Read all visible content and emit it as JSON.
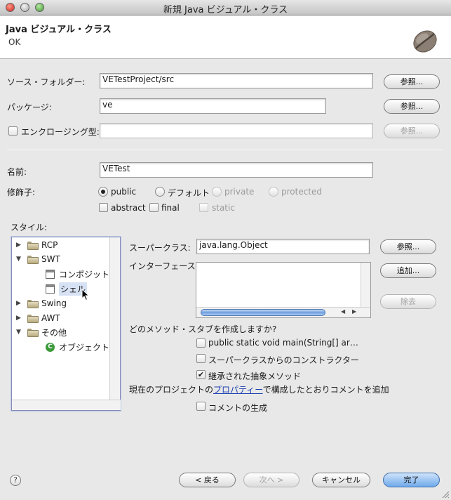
{
  "window": {
    "title": "新規 Java ビジュアル・クラス"
  },
  "header": {
    "title": "Java ビジュアル・クラス",
    "message": "OK"
  },
  "source_folder": {
    "label": "ソース・フォルダー:",
    "value": "VETestProject/src",
    "browse": "参照..."
  },
  "package": {
    "label": "パッケージ:",
    "value": "ve",
    "browse": "参照..."
  },
  "enclosing": {
    "label": "エンクロージング型:",
    "value": "",
    "browse": "参照..."
  },
  "name": {
    "label": "名前:",
    "value": "VETest"
  },
  "modifiers": {
    "label": "修飾子:",
    "radios": [
      "public",
      "デフォルト",
      "private",
      "protected"
    ],
    "checks": [
      "abstract",
      "final",
      "static"
    ]
  },
  "style": {
    "label": "スタイル:",
    "tree": {
      "rcp": "RCP",
      "swt": "SWT",
      "composite": "コンポジット",
      "shell": "シェル",
      "swing": "Swing",
      "awt": "AWT",
      "other": "その他",
      "object": "オブジェクト"
    }
  },
  "superclass": {
    "label": "スーパークラス:",
    "value": "java.lang.Object",
    "browse": "参照..."
  },
  "interfaces": {
    "label": "インターフェース:",
    "add": "追加...",
    "remove": "除去"
  },
  "stubs": {
    "question": "どのメソッド・スタブを作成しますか?",
    "main": "public static void main(String[] ar…",
    "constructors": "スーパークラスからのコンストラクター",
    "inherited": "継承された抽象メソッド"
  },
  "comments": {
    "prefix": "現在のプロジェクトの",
    "link": "プロパティー",
    "suffix": "で構成したとおりコメントを追加",
    "generate": "コメントの生成"
  },
  "footer": {
    "help": "?",
    "back": "< 戻る",
    "next": "次へ >",
    "cancel": "キャンセル",
    "finish": "完了"
  }
}
